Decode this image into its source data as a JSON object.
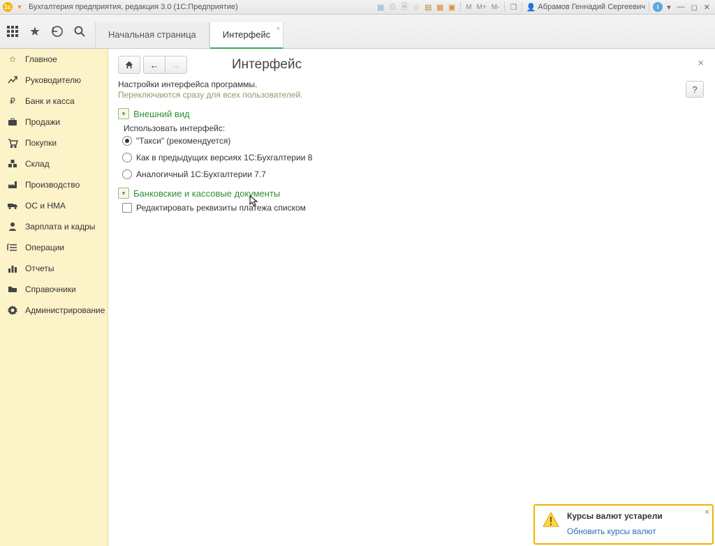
{
  "window": {
    "title": "Бухгалтерия предприятия, редакция 3.0  (1С:Предприятие)",
    "user": "Абрамов Геннадий Сергеевич",
    "marks": {
      "m": "M",
      "mp": "M+",
      "mm": "M-"
    }
  },
  "tabs": {
    "home": "Начальная страница",
    "current": "Интерфейс"
  },
  "sidebar": {
    "items": [
      {
        "label": "Главное"
      },
      {
        "label": "Руководителю"
      },
      {
        "label": "Банк и касса"
      },
      {
        "label": "Продажи"
      },
      {
        "label": "Покупки"
      },
      {
        "label": "Склад"
      },
      {
        "label": "Производство"
      },
      {
        "label": "ОС и НМА"
      },
      {
        "label": "Зарплата и кадры"
      },
      {
        "label": "Операции"
      },
      {
        "label": "Отчеты"
      },
      {
        "label": "Справочники"
      },
      {
        "label": "Администрирование"
      }
    ]
  },
  "page": {
    "title": "Интерфейс",
    "close": "×",
    "help": "?",
    "desc1": "Настройки интерфейса программы.",
    "desc2": "Переключаются сразу для всех пользователей.",
    "section1": {
      "title": "Внешний вид",
      "use_label": "Использовать интерфейс:",
      "opt1": "\"Такси\" (рекомендуется)",
      "opt2": "Как в предыдущих версиях 1С:Бухгалтерии 8",
      "opt3": "Аналогичный 1С:Бухгалтерии 7.7"
    },
    "section2": {
      "title": "Банковские и кассовые документы",
      "check1": "Редактировать реквизиты платежа списком"
    }
  },
  "notify": {
    "title": "Курсы валют устарели",
    "link": "Обновить курсы валют"
  }
}
